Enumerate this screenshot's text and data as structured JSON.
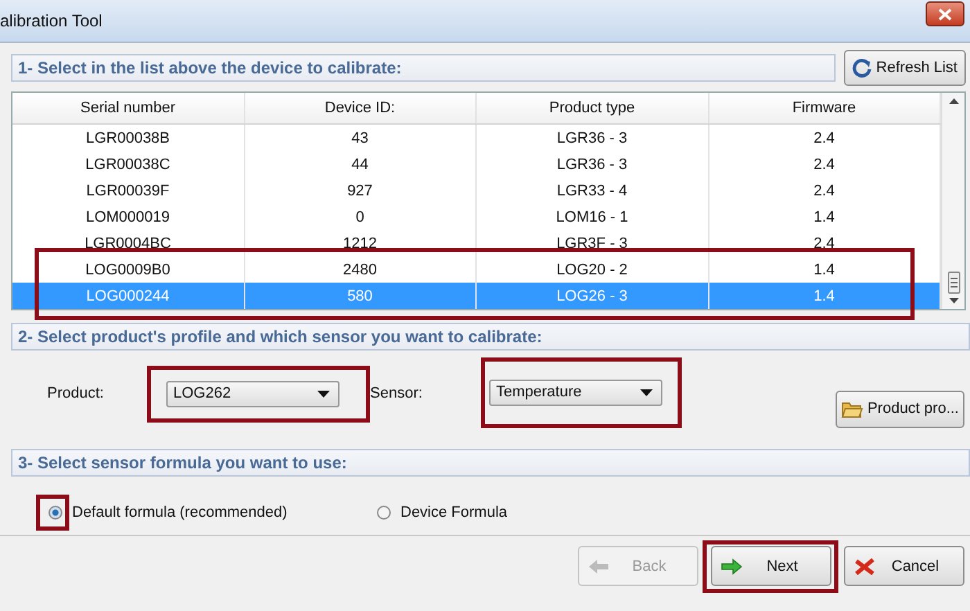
{
  "window": {
    "title": "alibration Tool"
  },
  "section_1": {
    "title": "1- Select in the list above the device to calibrate:",
    "refresh_button": "Refresh List"
  },
  "table": {
    "columns": [
      "Serial number",
      "Device ID:",
      "Product type",
      "Firmware"
    ],
    "rows": [
      {
        "cells": [
          "LGR00038B",
          "43",
          "LGR36 - 3",
          "2.4"
        ],
        "selected": false,
        "highlighted": false
      },
      {
        "cells": [
          "LGR00038C",
          "44",
          "LGR36 - 3",
          "2.4"
        ],
        "selected": false,
        "highlighted": false
      },
      {
        "cells": [
          "LGR00039F",
          "927",
          "LGR33 - 4",
          "2.4"
        ],
        "selected": false,
        "highlighted": false
      },
      {
        "cells": [
          "LOM000019",
          "0",
          "LOM16 - 1",
          "1.4"
        ],
        "selected": false,
        "highlighted": false
      },
      {
        "cells": [
          "LGR0004BC",
          "1212",
          "LGR3F - 3",
          "2.4"
        ],
        "selected": false,
        "highlighted": false
      },
      {
        "cells": [
          "LOG0009B0",
          "2480",
          "LOG20 - 2",
          "1.4"
        ],
        "selected": false,
        "highlighted": true
      },
      {
        "cells": [
          "LOG000244",
          "580",
          "LOG26 - 3",
          "1.4"
        ],
        "selected": true,
        "highlighted": true
      }
    ]
  },
  "section_2": {
    "title": "2- Select product's profile and which sensor you want to calibrate:",
    "product": {
      "label": "Product:",
      "value": "LOG262",
      "highlighted": true
    },
    "sensor": {
      "label": "Sensor:",
      "value": "Temperature",
      "highlighted": true
    },
    "profile_button": "Product pro..."
  },
  "section_3": {
    "title": "3- Select sensor formula you want to use:",
    "options": [
      {
        "label": "Default formula (recommended)",
        "selected": true,
        "highlighted": true
      },
      {
        "label": "Device Formula",
        "selected": false,
        "highlighted": false
      }
    ]
  },
  "buttons": [
    {
      "kind": "back",
      "label": "Back",
      "disabled": true,
      "highlighted": false
    },
    {
      "kind": "next",
      "label": "Next",
      "disabled": false,
      "highlighted": true
    },
    {
      "kind": "cancel",
      "label": "Cancel",
      "disabled": false,
      "highlighted": false
    }
  ]
}
